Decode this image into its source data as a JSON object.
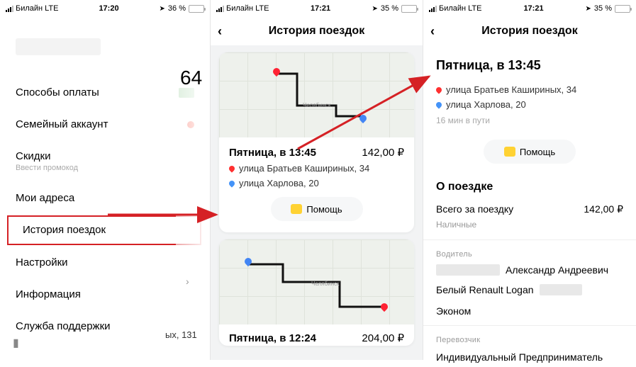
{
  "screen1": {
    "status": {
      "carrier": "Билайн",
      "net": "LTE",
      "time": "17:20",
      "battery": "36 %",
      "battery_pct": 36
    },
    "overlay": {
      "number_fragment": "64",
      "address_fragment": "ых, 131"
    },
    "menu": {
      "payment": "Способы оплаты",
      "family": "Семейный аккаунт",
      "discounts": "Скидки",
      "discounts_sub": "Ввести промокод",
      "addresses": "Мои адреса",
      "history": "История поездок",
      "settings": "Настройки",
      "info": "Информация",
      "support": "Служба поддержки"
    }
  },
  "screen2": {
    "status": {
      "carrier": "Билайн",
      "net": "LTE",
      "time": "17:21",
      "battery": "35 %",
      "battery_pct": 35
    },
    "title": "История поездок",
    "trip1": {
      "title": "Пятница, в 13:45",
      "price": "142,00 ₽",
      "from": "улица Братьев Кашириных, 34",
      "to": "улица Харлова, 20",
      "help": "Помощь",
      "map_city": "Челябинск"
    },
    "trip2": {
      "title": "Пятница, в 12:24",
      "price": "204,00 ₽",
      "map_city": "Челябинск"
    }
  },
  "screen3": {
    "status": {
      "carrier": "Билайн",
      "net": "LTE",
      "time": "17:21",
      "battery": "35 %",
      "battery_pct": 35
    },
    "title": "История поездок",
    "trip_title": "Пятница, в 13:45",
    "from": "улица Братьев Кашириных, 34",
    "to": "улица Харлова, 20",
    "duration": "16 мин в пути",
    "help": "Помощь",
    "about_label": "О поездке",
    "total_label": "Всего за поездку",
    "total_value": "142,00 ₽",
    "payment": "Наличные",
    "driver_label": "Водитель",
    "driver_name": "Александр Андреевич",
    "car": "Белый Renault Logan",
    "tariff": "Эконом",
    "carrier_label": "Перевозчик",
    "carrier": "Индивидуальный Предприниматель"
  }
}
